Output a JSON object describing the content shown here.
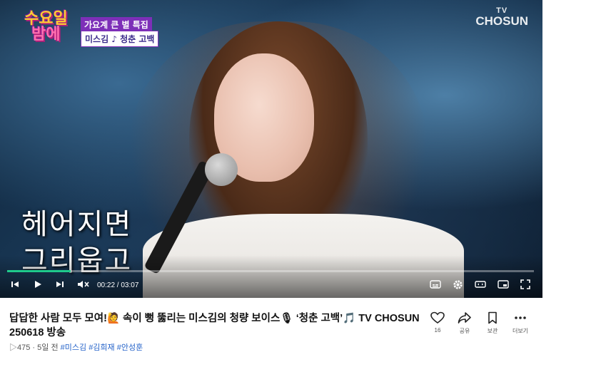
{
  "video": {
    "show_logo": [
      "수요일",
      "밤에"
    ],
    "caption_top": "가요계 큰 별 특집",
    "caption_bottom": "미스김 ♪ 청춘 고백",
    "channel_logo_top": "TV",
    "channel_logo_bottom": "CHOSUN",
    "lyrics": [
      "헤어지면",
      "그리웁고"
    ],
    "progress": 0.12
  },
  "controls": {
    "time": "00:22 / 03:07",
    "icons": [
      "skip-back-icon",
      "play-icon",
      "skip-forward-icon",
      "mute-icon",
      "subtitles-icon",
      "settings-icon",
      "theater-icon",
      "miniplayer-icon",
      "fullscreen-icon"
    ]
  },
  "info": {
    "title": "답답한 사람 모두 모여!🙋 속이 뻥 뚫리는 미스김의 청량 보이스🎙 ‘청춘 고백’🎵 TV CHOSUN 250618 방송",
    "views": "475",
    "age": "5일 전",
    "tags": [
      "#미스김",
      "#김희재",
      "#안성훈"
    ]
  },
  "actions": {
    "like_count": "16",
    "share_label": "공유",
    "save_label": "보관",
    "more_label": "더보기"
  },
  "colors": {
    "progress": "#1fc98b",
    "tag_link": "#2563c9",
    "caption_purple": "#7d2fb8"
  }
}
